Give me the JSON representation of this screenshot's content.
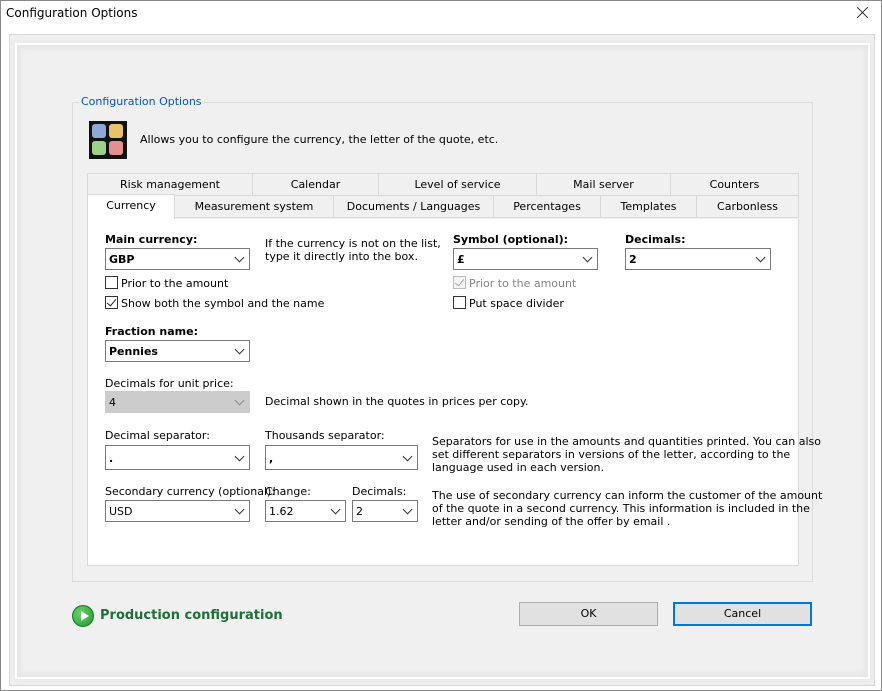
{
  "window": {
    "title": "Configuration Options"
  },
  "group": {
    "legend": "Configuration Options",
    "intro": "Allows you to configure the currency, the letter of the quote, etc."
  },
  "tabs": {
    "row_back": [
      "Risk management",
      "Calendar",
      "Level of service",
      "Mail server",
      "Counters"
    ],
    "row_front": [
      "Currency",
      "Measurement system",
      "Documents / Languages",
      "Percentages",
      "Templates",
      "Carbonless"
    ],
    "active": "Currency"
  },
  "currency": {
    "main_label": "Main currency:",
    "main_value": "GBP",
    "main_hint_1": "If the currency is not on the list,",
    "main_hint_2": "type it directly into the box.",
    "prior_amount": "Prior to the amount",
    "show_both": "Show both the symbol and the name",
    "symbol_label": "Symbol (optional):",
    "symbol_value": "£",
    "symbol_prior_amount": "Prior to the amount",
    "put_space": "Put space divider",
    "decimals_label": "Decimals:",
    "decimals_value": "2",
    "fraction_label": "Fraction name:",
    "fraction_value": "Pennies",
    "unit_price_label": "Decimals for unit price:",
    "unit_price_value": "4",
    "unit_price_desc": "Decimal shown in the quotes in prices per copy.",
    "decimal_sep_label": "Decimal separator:",
    "decimal_sep_value": ".",
    "thousands_sep_label": "Thousands separator:",
    "thousands_sep_value": ",",
    "separators_desc_1": "Separators for use in the amounts and quantities printed. You can also",
    "separators_desc_2": "set different separators in versions of the letter, according to the",
    "separators_desc_3": "language used in each version.",
    "secondary_label": "Secondary currency (optional):",
    "secondary_value": "USD",
    "change_label": "Change:",
    "change_value": "1.62",
    "sec_decimals_label": "Decimals:",
    "sec_decimals_value": "2",
    "secondary_desc_1": "The use of secondary currency can inform the customer of the amount",
    "secondary_desc_2": "of the quote in a second currency. This information is included in the",
    "secondary_desc_3": "letter and/or sending of the offer by email ."
  },
  "checkbox_states": {
    "prior_amount": false,
    "show_both": true,
    "symbol_prior_amount": true,
    "put_space": false
  },
  "footer": {
    "production_link": "Production configuration",
    "ok_label": "OK",
    "cancel_label": "Cancel"
  }
}
